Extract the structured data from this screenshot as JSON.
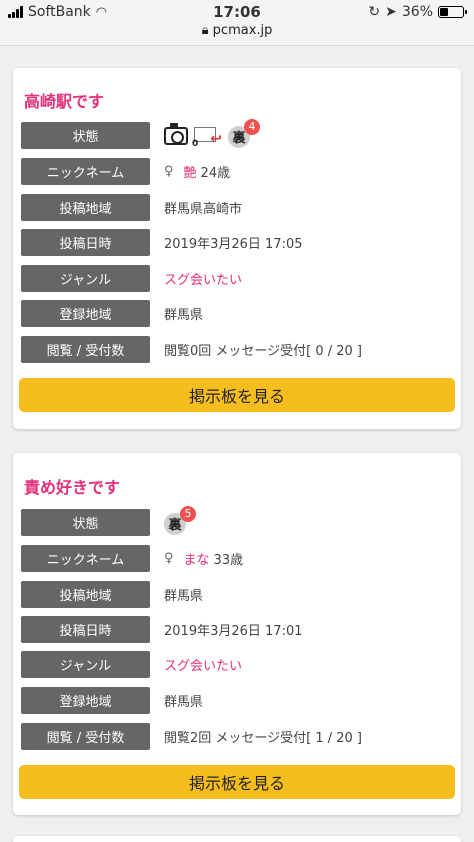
{
  "status_bar": {
    "carrier": "SoftBank",
    "time": "17:06",
    "url": "pcmax.jp",
    "battery": "36%",
    "battery_level": 0.36
  },
  "posts": [
    {
      "title": "高崎駅です",
      "labels": {
        "status": "状態",
        "nickname": "ニックネーム",
        "area": "投稿地域",
        "date": "投稿日時",
        "genre": "ジャンル",
        "reg_area": "登録地域",
        "views": "閲覧 / 受付数"
      },
      "mail_count": "0",
      "ura_badge": "4",
      "ura_char": "裏",
      "gender": "♀",
      "nickname": "艶",
      "age": "24歳",
      "area": "群馬県高崎市",
      "date": "2019年3月26日 17:05",
      "genre": "スグ会いたい",
      "reg_area": "群馬県",
      "views": "閲覧0回 メッセージ受付[ 0 / 20 ]",
      "button": "掲示板を見る"
    },
    {
      "title": "責め好きです",
      "labels": {
        "status": "状態",
        "nickname": "ニックネーム",
        "area": "投稿地域",
        "date": "投稿日時",
        "genre": "ジャンル",
        "reg_area": "登録地域",
        "views": "閲覧 / 受付数"
      },
      "ura_badge": "5",
      "ura_char": "裏",
      "gender": "♀",
      "nickname": "まな",
      "age": "33歳",
      "area": "群馬県",
      "date": "2019年3月26日 17:01",
      "genre": "スグ会いたい",
      "reg_area": "群馬県",
      "views": "閲覧2回 メッセージ受付[ 1 / 20 ]",
      "button": "掲示板を見る"
    }
  ]
}
